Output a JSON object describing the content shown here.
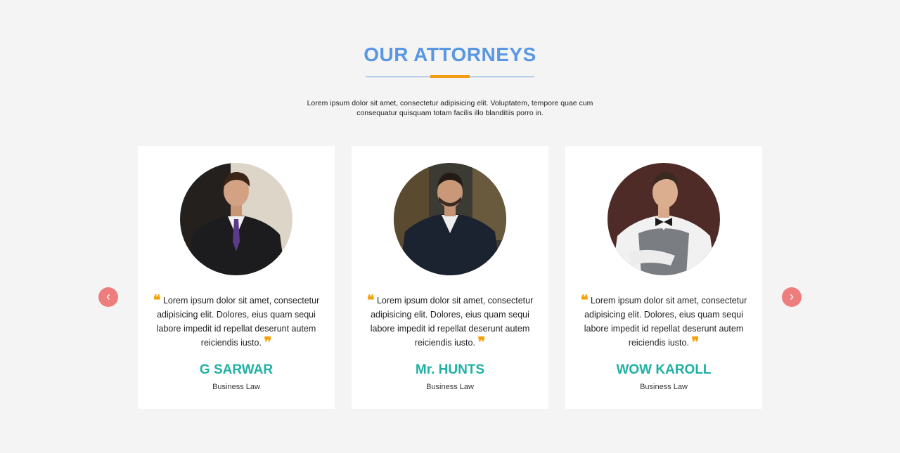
{
  "section": {
    "title": "OUR ATTORNEYS",
    "intro": "Lorem ipsum dolor sit amet, consectetur adipisicing elit. Voluptatem, tempore quae cum consequatur quisquam totam facilis illo blanditiis porro in."
  },
  "carousel": {
    "prev_label": "‹",
    "next_label": "›",
    "quote_open": "❝",
    "quote_close": "❞",
    "cards": [
      {
        "name": "G SARWAR",
        "role": "Business Law",
        "quote": "Lorem ipsum dolor sit amet, consectetur adipisicing elit. Dolores, eius quam sequi labore impedit id repellat deserunt autem reiciendis iusto.",
        "photo": "attorney-photo"
      },
      {
        "name": "Mr. HUNTS",
        "role": "Business Law",
        "quote": "Lorem ipsum dolor sit amet, consectetur adipisicing elit. Dolores, eius quam sequi labore impedit id repellat deserunt autem reiciendis iusto.",
        "photo": "attorney-photo"
      },
      {
        "name": "WOW KAROLL",
        "role": "Business Law",
        "quote": "Lorem ipsum dolor sit amet, consectetur adipisicing elit. Dolores, eius quam sequi labore impedit id repellat deserunt autem reiciendis iusto.",
        "photo": "attorney-photo"
      }
    ]
  },
  "colors": {
    "title": "#5a97e2",
    "accent": "#f39c12",
    "name": "#1fb0a4",
    "quote_mark": "#f5a20a",
    "nav_button": "#ee7d7d",
    "background": "#f4f4f4"
  }
}
